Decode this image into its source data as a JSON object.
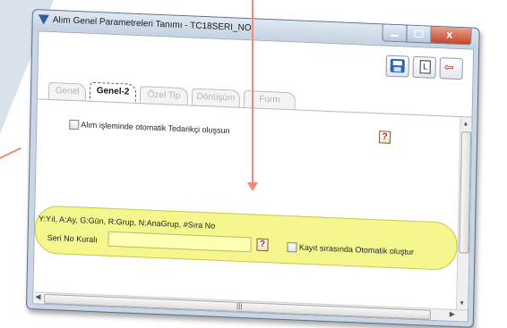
{
  "window": {
    "title": "Alım Genel Parametreleri Tanımı - TC18SERI_NO",
    "close_glyph": "x"
  },
  "toolbar": {
    "save_icon": "save-disk-icon",
    "l_label": "L",
    "exit_glyph": "⇦"
  },
  "tabs": [
    {
      "label": "Genel",
      "active": false
    },
    {
      "label": "Genel-2",
      "active": true
    },
    {
      "label": "Özel Tip",
      "active": false
    },
    {
      "label": "Dönüşüm",
      "active": false
    },
    {
      "label": "Form",
      "active": false
    }
  ],
  "form": {
    "auto_supplier_label": "Alım işleminde otomatik Tedarikçi oluşsun",
    "help_glyph": "?",
    "codes_hint": "Y:Yıl,  A:Ay,  G:Gün, R:Grup, N:AnaGrup, #Sıra No",
    "seri_label": "Seri No Kuralı",
    "seri_value": "",
    "auto_create_label": "Kayıt sırasında Otomatik oluştur"
  },
  "colors": {
    "highlight": "#f6f68e",
    "annotation_arrow": "#f08a78",
    "help_mark": "#c41f1f"
  }
}
